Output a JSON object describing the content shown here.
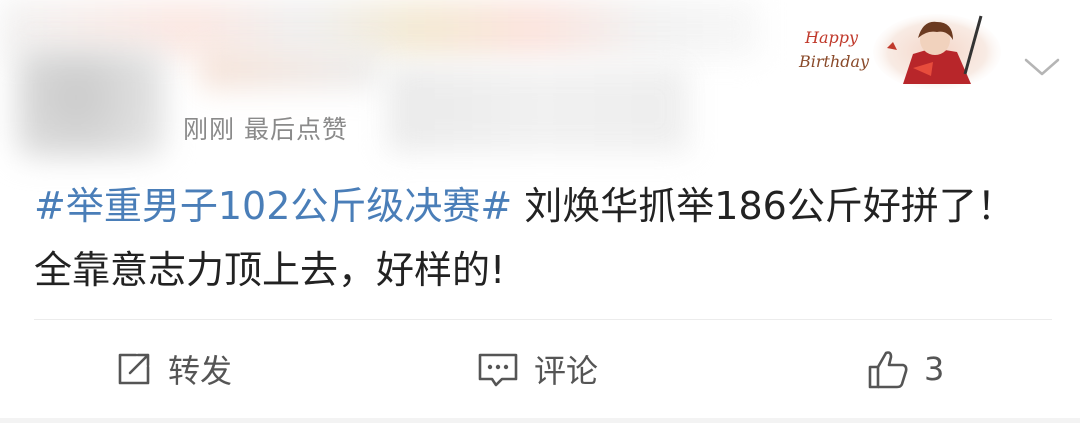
{
  "post": {
    "time": "刚刚",
    "meta_label": "最后点赞",
    "badge": {
      "line1": "Happy",
      "line2": "Birthday"
    },
    "hashtag": "#举重男子102公斤级决赛#",
    "body": " 刘焕华抓举186公斤好拼了！全靠意志力顶上去，好样的!"
  },
  "actions": {
    "forward_label": "转发",
    "comment_label": "评论",
    "like_count": "3"
  },
  "icons": {
    "menu": "chevron-down-icon",
    "forward": "share-icon",
    "comment": "comment-icon",
    "like": "thumbs-up-icon"
  },
  "colors": {
    "hashtag": "#4a7eb8",
    "text": "#222222",
    "secondary": "#8a8a8a",
    "icon": "#555555"
  }
}
